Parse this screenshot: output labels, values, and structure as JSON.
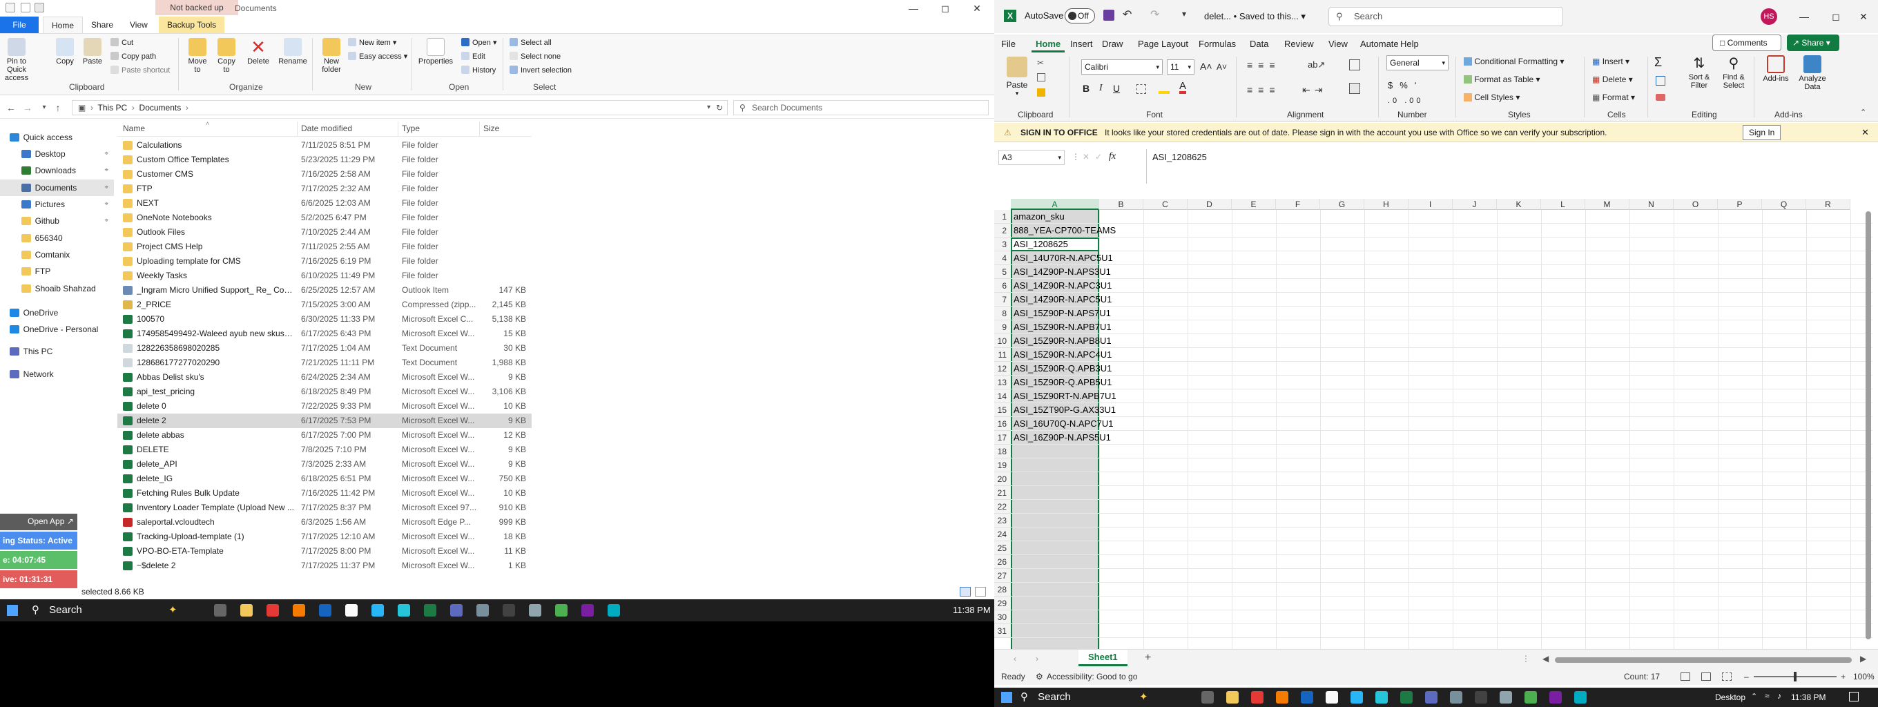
{
  "explorer": {
    "banner": "Not backed up",
    "window_title": "Documents",
    "tabs": [
      "File",
      "Home",
      "Share",
      "View",
      "Backup Tools"
    ],
    "ribbon": {
      "pin": "Pin to Quick access",
      "copy": "Copy",
      "paste": "Paste",
      "cut": "Cut",
      "copy_path": "Copy path",
      "paste_shortcut": "Paste shortcut",
      "move_to": "Move to",
      "copy_to": "Copy to",
      "delete": "Delete",
      "rename": "Rename",
      "new_folder": "New folder",
      "new_item": "New item",
      "easy_access": "Easy access",
      "properties": "Properties",
      "open": "Open",
      "edit": "Edit",
      "history": "History",
      "select_all": "Select all",
      "select_none": "Select none",
      "invert_selection": "Invert selection",
      "groups": [
        "Clipboard",
        "Organize",
        "New",
        "Open",
        "Select"
      ]
    },
    "address": {
      "path1": "This PC",
      "path2": "Documents",
      "search_placeholder": "Search Documents"
    },
    "nav": [
      {
        "label": "Quick access",
        "pin": false
      },
      {
        "label": "Desktop",
        "pin": true
      },
      {
        "label": "Downloads",
        "pin": true
      },
      {
        "label": "Documents",
        "pin": true
      },
      {
        "label": "Pictures",
        "pin": true
      },
      {
        "label": "Github",
        "pin": true
      },
      {
        "label": "656340",
        "pin": false
      },
      {
        "label": "Comtanix",
        "pin": false
      },
      {
        "label": "FTP",
        "pin": false
      },
      {
        "label": "Shoaib Shahzad",
        "pin": false
      },
      {
        "label": "OneDrive",
        "pin": false
      },
      {
        "label": "OneDrive - Personal",
        "pin": false
      },
      {
        "label": "This PC",
        "pin": false
      },
      {
        "label": "Network",
        "pin": false
      }
    ],
    "columns": [
      "Name",
      "Date modified",
      "Type",
      "Size"
    ],
    "files": [
      {
        "name": "Calculations",
        "date": "7/11/2025 8:51 PM",
        "type": "File folder",
        "size": "",
        "icon": "folder"
      },
      {
        "name": "Custom Office Templates",
        "date": "5/23/2025 11:29 PM",
        "type": "File folder",
        "size": "",
        "icon": "folder"
      },
      {
        "name": "Customer CMS",
        "date": "7/16/2025 2:58 AM",
        "type": "File folder",
        "size": "",
        "icon": "folder"
      },
      {
        "name": "FTP",
        "date": "7/17/2025 2:32 AM",
        "type": "File folder",
        "size": "",
        "icon": "folder"
      },
      {
        "name": "NEXT",
        "date": "6/6/2025 12:03 AM",
        "type": "File folder",
        "size": "",
        "icon": "folder"
      },
      {
        "name": "OneNote Notebooks",
        "date": "5/2/2025 6:47 PM",
        "type": "File folder",
        "size": "",
        "icon": "folder"
      },
      {
        "name": "Outlook Files",
        "date": "7/10/2025 2:44 AM",
        "type": "File folder",
        "size": "",
        "icon": "folder"
      },
      {
        "name": "Project CMS Help",
        "date": "7/11/2025 2:55 AM",
        "type": "File folder",
        "size": "",
        "icon": "folder"
      },
      {
        "name": "Uploading template for CMS",
        "date": "7/16/2025 6:19 PM",
        "type": "File folder",
        "size": "",
        "icon": "folder"
      },
      {
        "name": "Weekly Tasks",
        "date": "6/10/2025 11:49 PM",
        "type": "File folder",
        "size": "",
        "icon": "folder"
      },
      {
        "name": "_Ingram Micro Unified Support_ Re_ Con...",
        "date": "6/25/2025 12:57 AM",
        "type": "Outlook Item",
        "size": "147 KB",
        "icon": "mail"
      },
      {
        "name": "2_PRICE",
        "date": "7/15/2025 3:00 AM",
        "type": "Compressed (zipp...",
        "size": "2,145 KB",
        "icon": "zip"
      },
      {
        "name": "100570",
        "date": "6/30/2025 11:33 PM",
        "type": "Microsoft Excel C...",
        "size": "5,138 KB",
        "icon": "excel"
      },
      {
        "name": "1749585499492-Waleed ayub new skus(A...",
        "date": "6/17/2025 6:43 PM",
        "type": "Microsoft Excel W...",
        "size": "15 KB",
        "icon": "excel"
      },
      {
        "name": "128226358698020285",
        "date": "7/17/2025 1:04 AM",
        "type": "Text Document",
        "size": "30 KB",
        "icon": "text"
      },
      {
        "name": "128686177277020290",
        "date": "7/21/2025 11:11 PM",
        "type": "Text Document",
        "size": "1,988 KB",
        "icon": "text"
      },
      {
        "name": "Abbas Delist sku's",
        "date": "6/24/2025 2:34 AM",
        "type": "Microsoft Excel W...",
        "size": "9 KB",
        "icon": "excel"
      },
      {
        "name": "api_test_pricing",
        "date": "6/18/2025 8:49 PM",
        "type": "Microsoft Excel W...",
        "size": "3,106 KB",
        "icon": "excel"
      },
      {
        "name": "delete 0",
        "date": "7/22/2025 9:33 PM",
        "type": "Microsoft Excel W...",
        "size": "10 KB",
        "icon": "excel"
      },
      {
        "name": "delete 2",
        "date": "6/17/2025 7:53 PM",
        "type": "Microsoft Excel W...",
        "size": "9 KB",
        "icon": "excel",
        "selected": true
      },
      {
        "name": "delete abbas",
        "date": "6/17/2025 7:00 PM",
        "type": "Microsoft Excel W...",
        "size": "12 KB",
        "icon": "excel"
      },
      {
        "name": "DELETE",
        "date": "7/8/2025 7:10 PM",
        "type": "Microsoft Excel W...",
        "size": "9 KB",
        "icon": "excel"
      },
      {
        "name": "delete_API",
        "date": "7/3/2025 2:33 AM",
        "type": "Microsoft Excel W...",
        "size": "9 KB",
        "icon": "excel"
      },
      {
        "name": "delete_IG",
        "date": "6/18/2025 6:51 PM",
        "type": "Microsoft Excel W...",
        "size": "750 KB",
        "icon": "excel"
      },
      {
        "name": "Fetching Rules Bulk Update",
        "date": "7/16/2025 11:42 PM",
        "type": "Microsoft Excel W...",
        "size": "10 KB",
        "icon": "excel"
      },
      {
        "name": "Inventory Loader Template (Upload New ...",
        "date": "7/17/2025 8:37 PM",
        "type": "Microsoft Excel 97...",
        "size": "910 KB",
        "icon": "excel"
      },
      {
        "name": "saleportal.vcloudtech",
        "date": "6/3/2025 1:56 AM",
        "type": "Microsoft Edge P...",
        "size": "999 KB",
        "icon": "pdf"
      },
      {
        "name": "Tracking-Upload-template (1)",
        "date": "7/17/2025 12:10 AM",
        "type": "Microsoft Excel W...",
        "size": "18 KB",
        "icon": "excel"
      },
      {
        "name": "VPO-BO-ETA-Template",
        "date": "7/17/2025 8:00 PM",
        "type": "Microsoft Excel W...",
        "size": "11 KB",
        "icon": "excel"
      },
      {
        "name": "~$delete 2",
        "date": "7/17/2025 11:37 PM",
        "type": "Microsoft Excel W...",
        "size": "1 KB",
        "icon": "excel"
      }
    ],
    "status": "selected  8.66 KB",
    "overlay": {
      "open_app": "Open App",
      "status_line": "ing Status: Active",
      "timer1": "e: 04:07:45",
      "timer2": "ive: 01:31:31"
    }
  },
  "taskbar_left": {
    "search": "Search",
    "time": "11:38 PM"
  },
  "excel": {
    "autosave_label": "AutoSave",
    "autosave_state": "Off",
    "doc_title": "delet...",
    "saved_status": "Saved to this...",
    "search_placeholder": "Search",
    "avatar": "HS",
    "menu": [
      "File",
      "Home",
      "Insert",
      "Draw",
      "Page Layout",
      "Formulas",
      "Data",
      "Review",
      "View",
      "Automate",
      "Help"
    ],
    "comments": "Comments",
    "share": "Share",
    "ribbon": {
      "paste": "Paste",
      "clipboard": "Clipboard",
      "font_name": "Calibri",
      "font_size": "11",
      "font_label": "Font",
      "alignment_label": "Alignment",
      "number_format": "General",
      "number_label": "Number",
      "conditional": "Conditional Formatting",
      "format_table": "Format as Table",
      "cell_styles": "Cell Styles",
      "styles_label": "Styles",
      "insert": "Insert",
      "delete": "Delete",
      "format": "Format",
      "cells_label": "Cells",
      "sort_filter": "Sort & Filter",
      "find_select": "Find & Select",
      "editing_label": "Editing",
      "addins": "Add-ins",
      "analyze": "Analyze Data",
      "addins_label": "Add-ins"
    },
    "message": {
      "title": "SIGN IN TO OFFICE",
      "text": "It looks like your stored credentials are out of date. Please sign in with the account you use with Office so we can verify your subscription.",
      "button": "Sign In"
    },
    "name_box": "A3",
    "formula": "ASI_1208625",
    "columns": [
      "A",
      "B",
      "C",
      "D",
      "E",
      "F",
      "G",
      "H",
      "I",
      "J",
      "K",
      "L",
      "M",
      "N",
      "O",
      "P",
      "Q",
      "R"
    ],
    "rows": [
      "1",
      "2",
      "3",
      "4",
      "5",
      "6",
      "7",
      "8",
      "9",
      "10",
      "11",
      "12",
      "13",
      "14",
      "15",
      "16",
      "17",
      "18",
      "19",
      "20",
      "21",
      "22",
      "23",
      "24",
      "25",
      "26",
      "27",
      "28",
      "29",
      "30",
      "31"
    ],
    "cells_a": [
      "amazon_sku",
      "888_YEA-CP700-TEAMS",
      "ASI_1208625",
      "ASI_14U70R-N.APC5U1",
      "ASI_14Z90P-N.APS3U1",
      "ASI_14Z90R-N.APC3U1",
      "ASI_14Z90R-N.APC5U1",
      "ASI_15Z90P-N.APS7U1",
      "ASI_15Z90R-N.APB7U1",
      "ASI_15Z90R-N.APB8U1",
      "ASI_15Z90R-N.APC4U1",
      "ASI_15Z90R-Q.APB3U1",
      "ASI_15Z90R-Q.APB5U1",
      "ASI_15Z90RT-N.APB7U1",
      "ASI_15ZT90P-G.AX33U1",
      "ASI_16U70Q-N.APC7U1",
      "ASI_16Z90P-N.APS5U1"
    ],
    "sheet_tab": "Sheet1",
    "status_ready": "Ready",
    "status_access": "Accessibility: Good to go",
    "count": "Count: 17",
    "zoom": "100%"
  },
  "taskbar_right": {
    "search": "Search",
    "desktop": "Desktop",
    "time": "11:38 PM"
  }
}
